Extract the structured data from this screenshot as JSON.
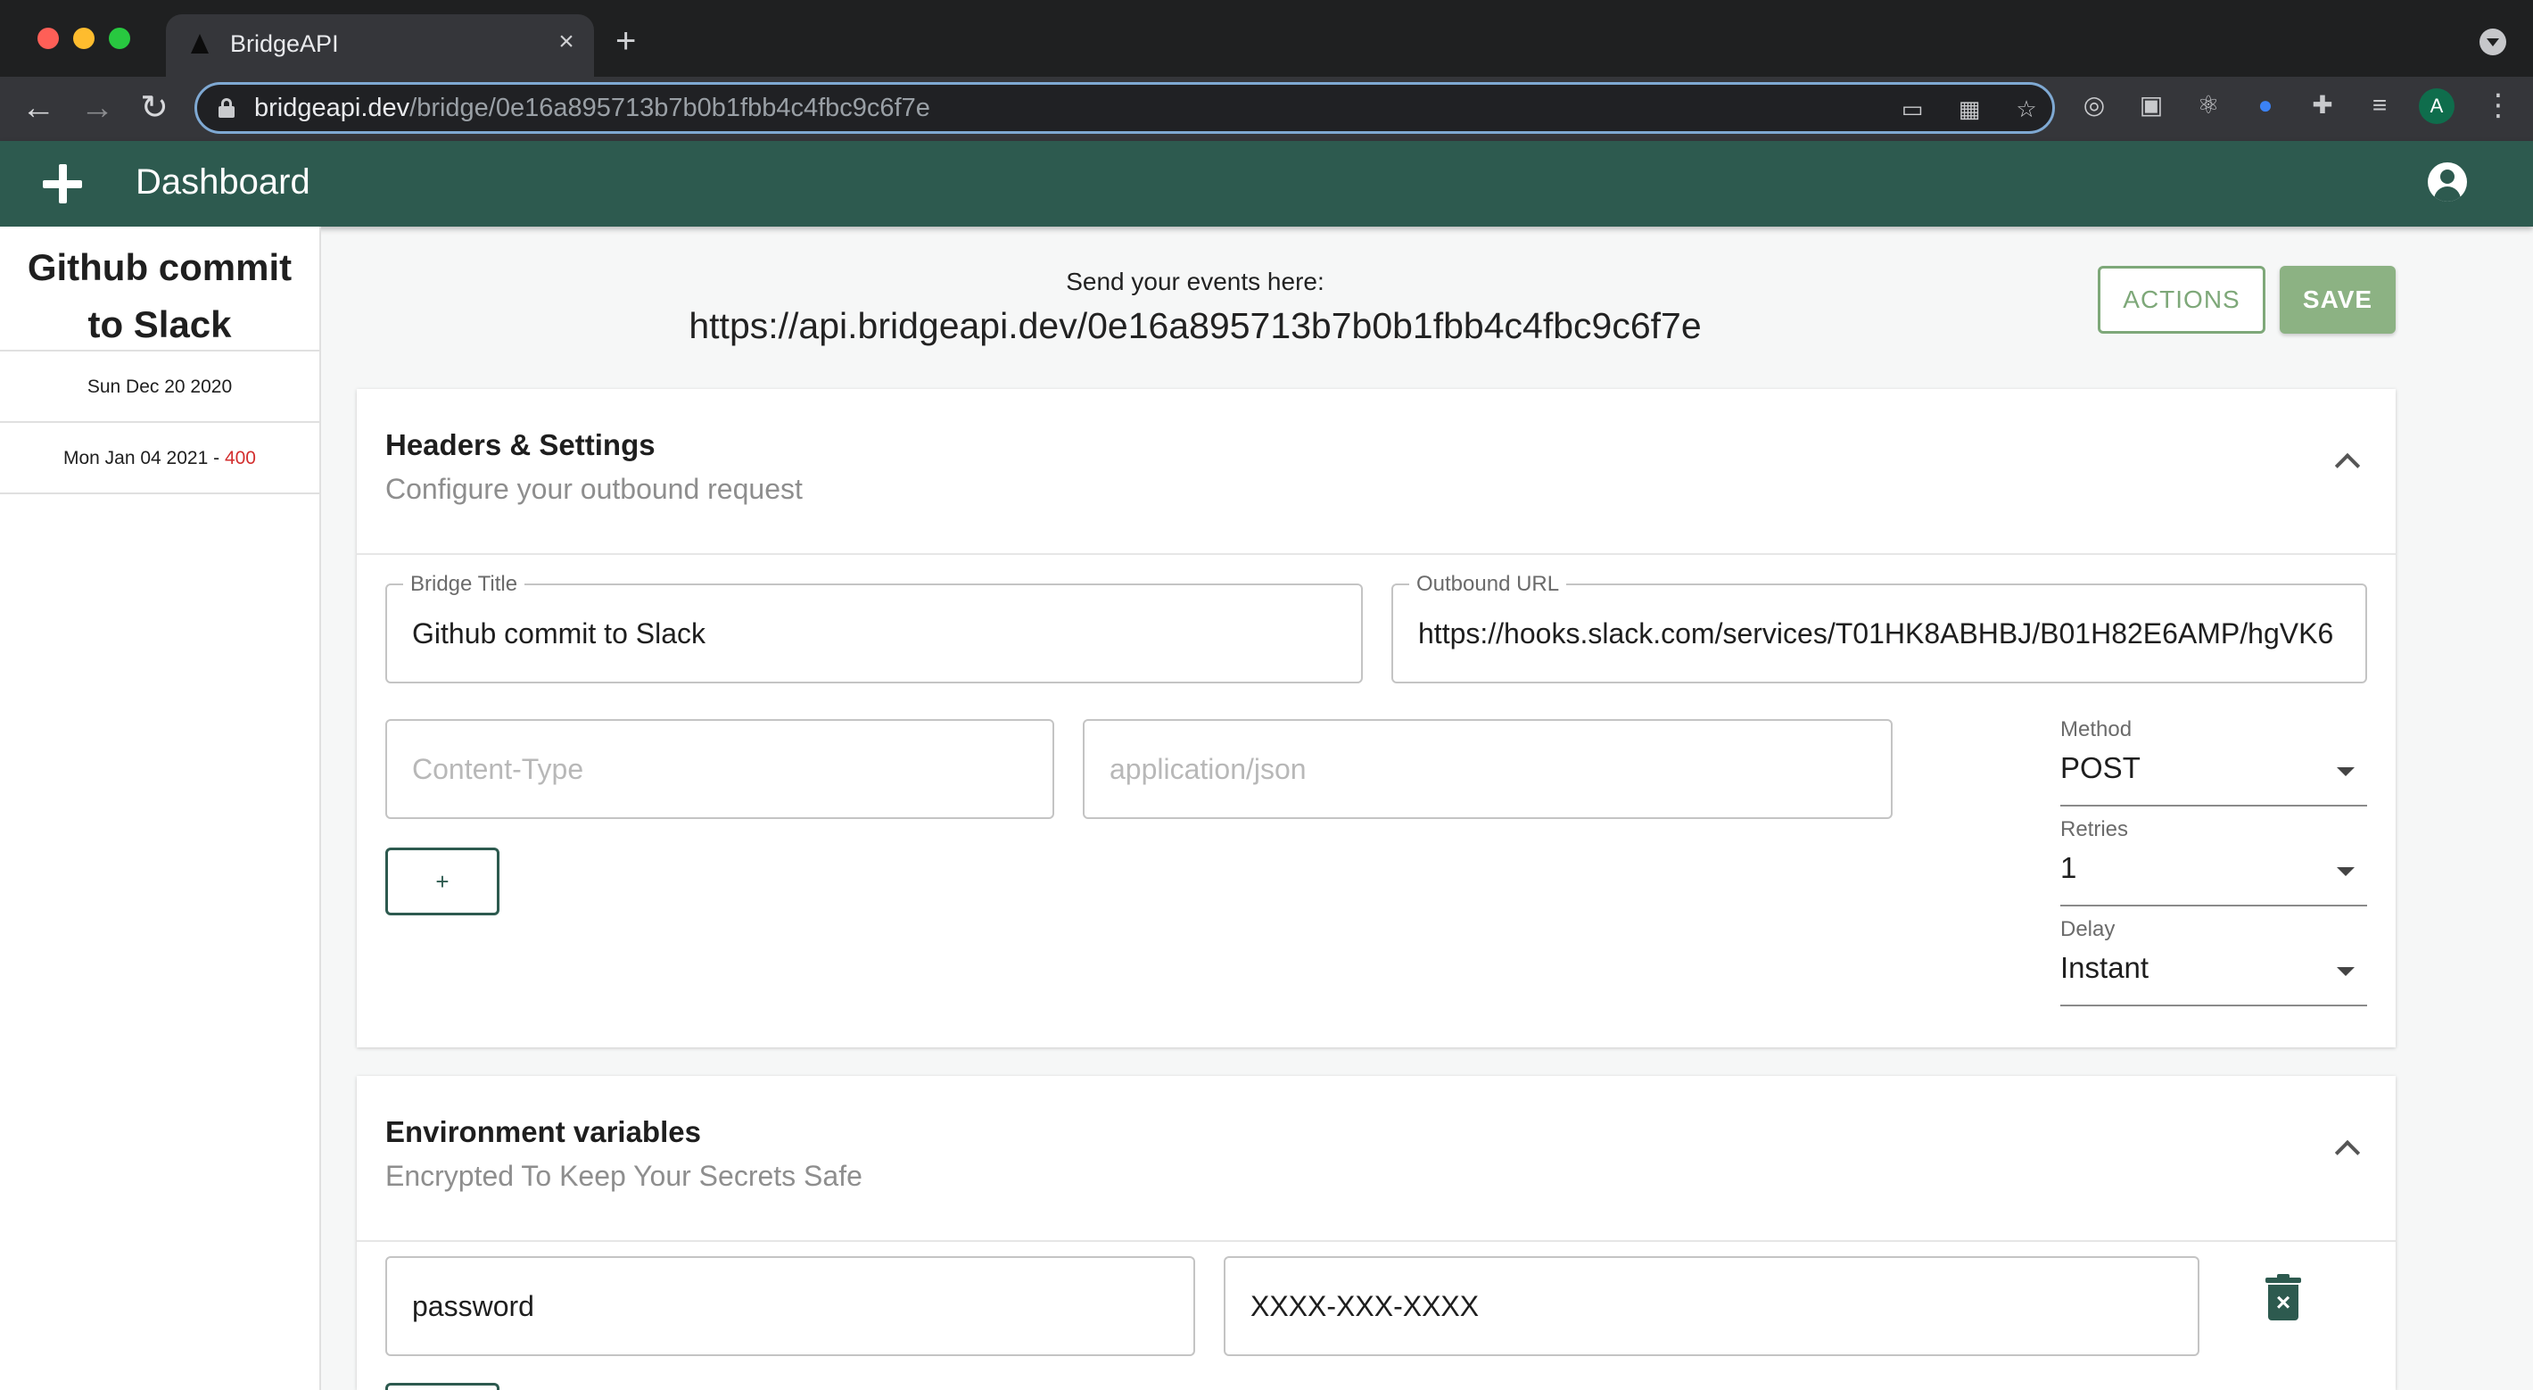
{
  "browser": {
    "tab_title": "BridgeAPI",
    "url_host": "bridgeapi.dev",
    "url_path": "/bridge/0e16a895713b7b0b1fbb4c4fbc9c6f7e",
    "profile_initial": "A"
  },
  "appbar": {
    "title": "Dashboard"
  },
  "sidebar": {
    "title": "Github commit to Slack",
    "items": [
      {
        "date": "Sun Dec 20 2020",
        "status": ""
      },
      {
        "date": "Mon Jan 04 2021",
        "separator": " - ",
        "status": "400"
      }
    ]
  },
  "main": {
    "send_label": "Send your events here:",
    "send_url": "https://api.bridgeapi.dev/0e16a895713b7b0b1fbb4c4fbc9c6f7e",
    "actions_label": "ACTIONS",
    "save_label": "SAVE"
  },
  "headers_panel": {
    "title": "Headers & Settings",
    "subtitle": "Configure your outbound request",
    "bridge_title_label": "Bridge Title",
    "bridge_title_value": "Github commit to Slack",
    "outbound_url_label": "Outbound URL",
    "outbound_url_value": "https://hooks.slack.com/services/T01HK8ABHBJ/B01H82E6AMP/hgVK6",
    "header_key_placeholder": "Content-Type",
    "header_value_placeholder": "application/json",
    "add_label": "+",
    "method_label": "Method",
    "method_value": "POST",
    "retries_label": "Retries",
    "retries_value": "1",
    "delay_label": "Delay",
    "delay_value": "Instant"
  },
  "env_panel": {
    "title": "Environment variables",
    "subtitle": "Encrypted To Keep Your Secrets Safe",
    "var_key": "password",
    "var_value": "XXXX-XXX-XXXX"
  },
  "colors": {
    "appbar": "#2d5a4f",
    "accent_light": "#8cb283",
    "error": "#d32f2f"
  }
}
